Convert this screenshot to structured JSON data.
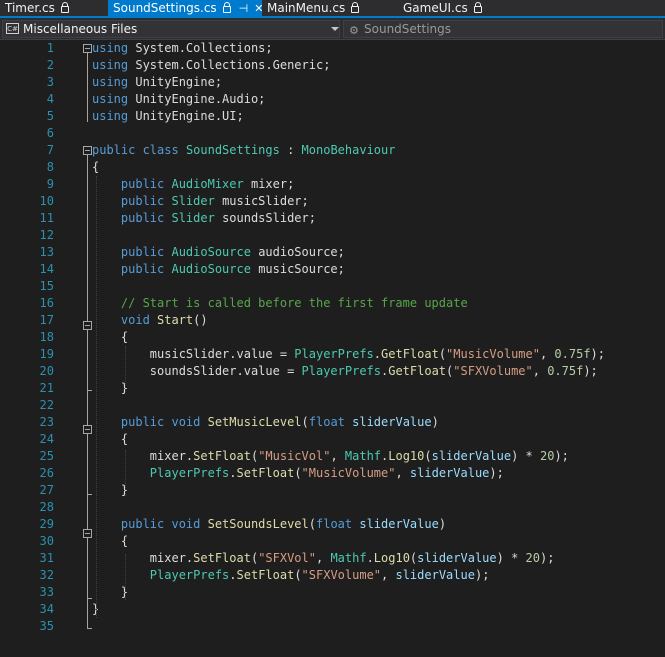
{
  "tabs": [
    {
      "label": "Timer.cs",
      "active": false,
      "pinned": false
    },
    {
      "label": "SoundSettings.cs",
      "active": true,
      "pinned": true
    },
    {
      "label": "MainMenu.cs",
      "active": false,
      "pinned": false
    },
    {
      "label": "GameUI.cs",
      "active": false,
      "pinned": false
    }
  ],
  "tab_icons": {
    "pin": "⊣",
    "close": "✕"
  },
  "nav": {
    "project_icon_text": "C#",
    "project": "Miscellaneous Files",
    "member": "SoundSettings"
  },
  "colors": {
    "accent": "#007acc",
    "keyword": "#569cd6",
    "type": "#4ec9b0",
    "method": "#dcdcaa",
    "string": "#d69d85",
    "comment": "#57a64a",
    "parameter": "#9cdcfe",
    "number": "#b5cea8",
    "line_number": "#2b91af"
  },
  "lines": [
    {
      "n": "1",
      "tokens": [
        [
          "k",
          "using"
        ],
        [
          "",
          "System.Collections;"
        ]
      ]
    },
    {
      "n": "2",
      "tokens": [
        [
          "k",
          "using"
        ],
        [
          "",
          "System.Collections.Generic;"
        ]
      ]
    },
    {
      "n": "3",
      "tokens": [
        [
          "k",
          "using"
        ],
        [
          "",
          "UnityEngine;"
        ]
      ]
    },
    {
      "n": "4",
      "tokens": [
        [
          "k",
          "using"
        ],
        [
          "",
          "UnityEngine.Audio;"
        ]
      ]
    },
    {
      "n": "5",
      "tokens": [
        [
          "k",
          "using"
        ],
        [
          "",
          "UnityEngine.UI;"
        ]
      ]
    },
    {
      "n": "6",
      "tokens": []
    },
    {
      "n": "7",
      "tokens": [
        [
          "k",
          "public"
        ],
        [
          "k",
          "class"
        ],
        [
          "t",
          "SoundSettings"
        ],
        [
          "",
          ":"
        ],
        [
          "t",
          "MonoBehaviour"
        ]
      ]
    },
    {
      "n": "8",
      "tokens": [
        [
          "",
          "{"
        ]
      ]
    },
    {
      "n": "9",
      "tokens": [
        [
          "k",
          "    public"
        ],
        [
          "t",
          "AudioMixer"
        ],
        [
          "",
          "mixer;"
        ]
      ]
    },
    {
      "n": "10",
      "tokens": [
        [
          "k",
          "    public"
        ],
        [
          "t",
          "Slider"
        ],
        [
          "",
          "musicSlider;"
        ]
      ]
    },
    {
      "n": "11",
      "tokens": [
        [
          "k",
          "    public"
        ],
        [
          "t",
          "Slider"
        ],
        [
          "",
          "soundsSlider;"
        ]
      ]
    },
    {
      "n": "12",
      "tokens": []
    },
    {
      "n": "13",
      "tokens": [
        [
          "k",
          "    public"
        ],
        [
          "t",
          "AudioSource"
        ],
        [
          "",
          "audioSource;"
        ]
      ]
    },
    {
      "n": "14",
      "tokens": [
        [
          "k",
          "    public"
        ],
        [
          "t",
          "AudioSource"
        ],
        [
          "",
          "musicSource;"
        ]
      ]
    },
    {
      "n": "15",
      "tokens": []
    },
    {
      "n": "16",
      "tokens": [
        [
          "c",
          "    // Start is called before the first frame update"
        ]
      ]
    },
    {
      "n": "17",
      "tokens": [
        [
          "k",
          "    void"
        ],
        [
          "m",
          "Start"
        ],
        [
          "",
          "()"
        ]
      ]
    },
    {
      "n": "18",
      "tokens": [
        [
          "",
          "    {"
        ]
      ]
    },
    {
      "n": "19",
      "tokens": [
        [
          "",
          "        musicSlider.value = "
        ],
        [
          "t",
          "PlayerPrefs"
        ],
        [
          "",
          "."
        ],
        [
          "m",
          "GetFloat"
        ],
        [
          "",
          "("
        ],
        [
          "s",
          "\"MusicVolume\""
        ],
        [
          "",
          ", "
        ],
        [
          "n",
          "0.75f"
        ],
        [
          "",
          ");"
        ]
      ]
    },
    {
      "n": "20",
      "tokens": [
        [
          "",
          "        soundsSlider.value = "
        ],
        [
          "t",
          "PlayerPrefs"
        ],
        [
          "",
          "."
        ],
        [
          "m",
          "GetFloat"
        ],
        [
          "",
          "("
        ],
        [
          "s",
          "\"SFXVolume\""
        ],
        [
          "",
          ", "
        ],
        [
          "n",
          "0.75f"
        ],
        [
          "",
          ");"
        ]
      ]
    },
    {
      "n": "21",
      "tokens": [
        [
          "",
          "    }"
        ]
      ]
    },
    {
      "n": "22",
      "tokens": []
    },
    {
      "n": "23",
      "tokens": [
        [
          "k",
          "    public"
        ],
        [
          "k",
          "void"
        ],
        [
          "m",
          "SetMusicLevel"
        ],
        [
          "",
          "("
        ],
        [
          "k",
          "float"
        ],
        [
          "p",
          "sliderValue"
        ],
        [
          "",
          ")"
        ]
      ]
    },
    {
      "n": "24",
      "tokens": [
        [
          "",
          "    {"
        ]
      ]
    },
    {
      "n": "25",
      "tokens": [
        [
          "",
          "        mixer."
        ],
        [
          "m",
          "SetFloat"
        ],
        [
          "",
          "("
        ],
        [
          "s",
          "\"MusicVol\""
        ],
        [
          "",
          ", "
        ],
        [
          "t",
          "Mathf"
        ],
        [
          "",
          "."
        ],
        [
          "m",
          "Log10"
        ],
        [
          "",
          "("
        ],
        [
          "p",
          "sliderValue"
        ],
        [
          "",
          ") * "
        ],
        [
          "n",
          "20"
        ],
        [
          "",
          ");"
        ]
      ]
    },
    {
      "n": "26",
      "tokens": [
        [
          "t",
          "        PlayerPrefs"
        ],
        [
          "",
          "."
        ],
        [
          "m",
          "SetFloat"
        ],
        [
          "",
          "("
        ],
        [
          "s",
          "\"MusicVolume\""
        ],
        [
          "",
          ", "
        ],
        [
          "p",
          "sliderValue"
        ],
        [
          "",
          ");"
        ]
      ]
    },
    {
      "n": "27",
      "tokens": [
        [
          "",
          "    }"
        ]
      ]
    },
    {
      "n": "28",
      "tokens": []
    },
    {
      "n": "29",
      "tokens": [
        [
          "k",
          "    public"
        ],
        [
          "k",
          "void"
        ],
        [
          "m",
          "SetSoundsLevel"
        ],
        [
          "",
          "("
        ],
        [
          "k",
          "float"
        ],
        [
          "p",
          "sliderValue"
        ],
        [
          "",
          ")"
        ]
      ]
    },
    {
      "n": "30",
      "tokens": [
        [
          "",
          "    {"
        ]
      ]
    },
    {
      "n": "31",
      "tokens": [
        [
          "",
          "        mixer."
        ],
        [
          "m",
          "SetFloat"
        ],
        [
          "",
          "("
        ],
        [
          "s",
          "\"SFXVol\""
        ],
        [
          "",
          ", "
        ],
        [
          "t",
          "Mathf"
        ],
        [
          "",
          "."
        ],
        [
          "m",
          "Log10"
        ],
        [
          "",
          "("
        ],
        [
          "p",
          "sliderValue"
        ],
        [
          "",
          ") * "
        ],
        [
          "n",
          "20"
        ],
        [
          "",
          ");"
        ]
      ]
    },
    {
      "n": "32",
      "tokens": [
        [
          "t",
          "        PlayerPrefs"
        ],
        [
          "",
          "."
        ],
        [
          "m",
          "SetFloat"
        ],
        [
          "",
          "("
        ],
        [
          "s",
          "\"SFXVolume\""
        ],
        [
          "",
          ", "
        ],
        [
          "p",
          "sliderValue"
        ],
        [
          "",
          ");"
        ]
      ]
    },
    {
      "n": "33",
      "tokens": [
        [
          "",
          "    }"
        ]
      ]
    },
    {
      "n": "34",
      "tokens": [
        [
          "",
          "}"
        ]
      ]
    },
    {
      "n": "35",
      "tokens": []
    }
  ]
}
